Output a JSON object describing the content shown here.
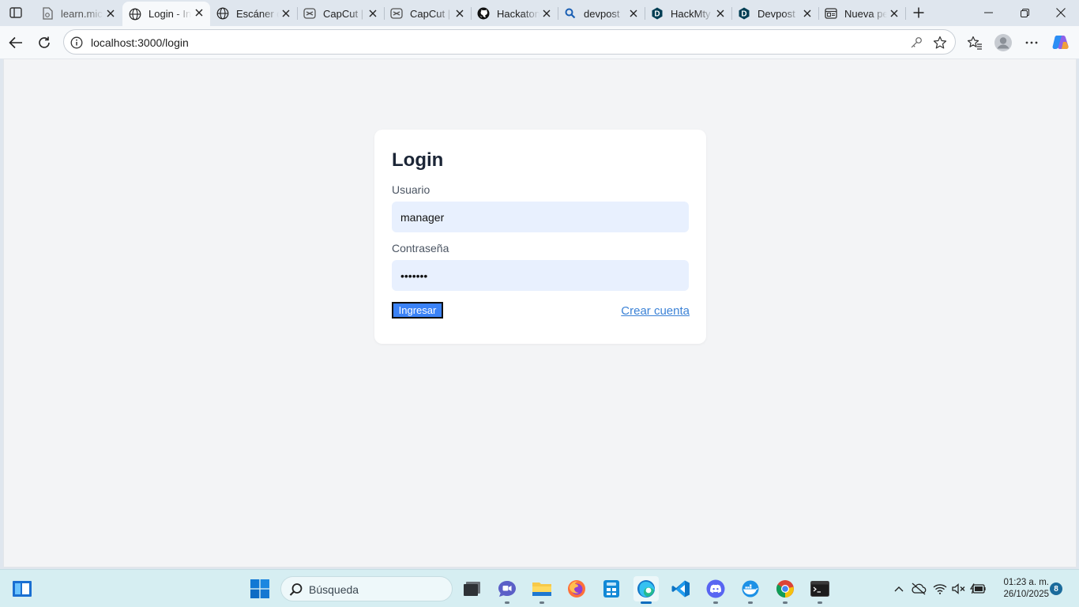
{
  "browser": {
    "tabs": [
      {
        "title": "learn.mic",
        "icon": "page-icon"
      },
      {
        "title": "Login - In",
        "icon": "globe-icon",
        "active": true
      },
      {
        "title": "Escáner d",
        "icon": "globe-icon"
      },
      {
        "title": "CapCut |",
        "icon": "capcut-icon"
      },
      {
        "title": "CapCut |",
        "icon": "capcut-icon"
      },
      {
        "title": "Hackaton",
        "icon": "github-icon"
      },
      {
        "title": "devpost",
        "icon": "search-icon"
      },
      {
        "title": "HackMty",
        "icon": "devpost-icon"
      },
      {
        "title": "Devpost",
        "icon": "devpost-icon"
      },
      {
        "title": "Nueva pe",
        "icon": "newtab-page-icon"
      }
    ],
    "address": {
      "url": "localhost:3000/login"
    }
  },
  "page": {
    "heading": "Login",
    "username_label": "Usuario",
    "username_value": "manager",
    "password_label": "Contraseña",
    "password_value": "•••••••",
    "submit_label": "Ingresar",
    "create_account_link": "Crear cuenta"
  },
  "taskbar": {
    "search_placeholder": "Búsqueda",
    "apps": [
      "task-view",
      "teams",
      "file-explorer",
      "firefox",
      "calculator",
      "edge",
      "vscode",
      "discord",
      "docker",
      "chrome",
      "terminal"
    ],
    "time": "01:23 a. m.",
    "date": "26/10/2025",
    "notification_count": "8"
  },
  "colors": {
    "accent": "#3b82f6",
    "link": "#3b82d6",
    "input_bg": "#e8f0fe",
    "page_bg": "#f3f4f6"
  }
}
